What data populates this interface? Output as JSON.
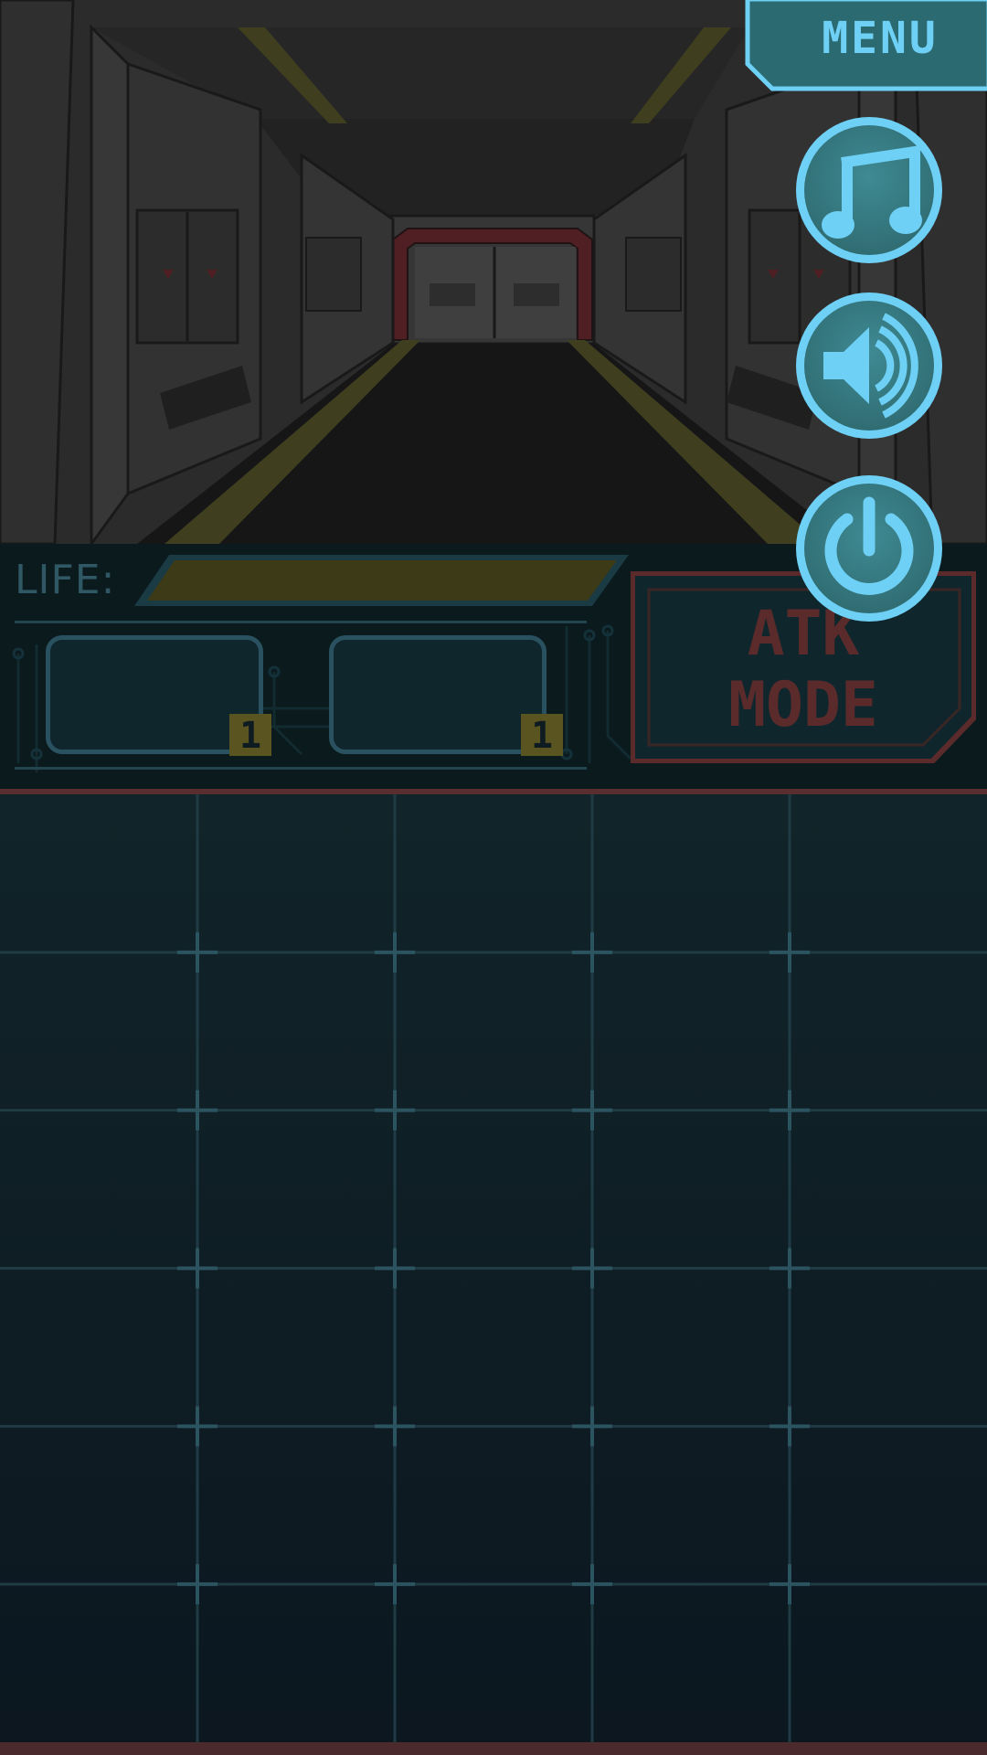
{
  "top_menu": {
    "menu_label": "MENU"
  },
  "side_buttons": [
    {
      "name": "music-toggle",
      "icon": "music-note-icon"
    },
    {
      "name": "sound-toggle",
      "icon": "speaker-icon"
    },
    {
      "name": "power",
      "icon": "power-icon"
    }
  ],
  "hud": {
    "life_label": "LIFE:",
    "life_fraction": 1.0,
    "item_slots": [
      {
        "count": "1"
      },
      {
        "count": "1"
      }
    ],
    "attack_mode_label": "ATK\nMODE"
  },
  "grid": {
    "rows": 6,
    "cols": 5
  },
  "colors": {
    "accent": "#6fd0f5",
    "life_fill": "#3d3a18",
    "attack_border": "#5b2b2b",
    "hud_border": "#2a5160"
  }
}
